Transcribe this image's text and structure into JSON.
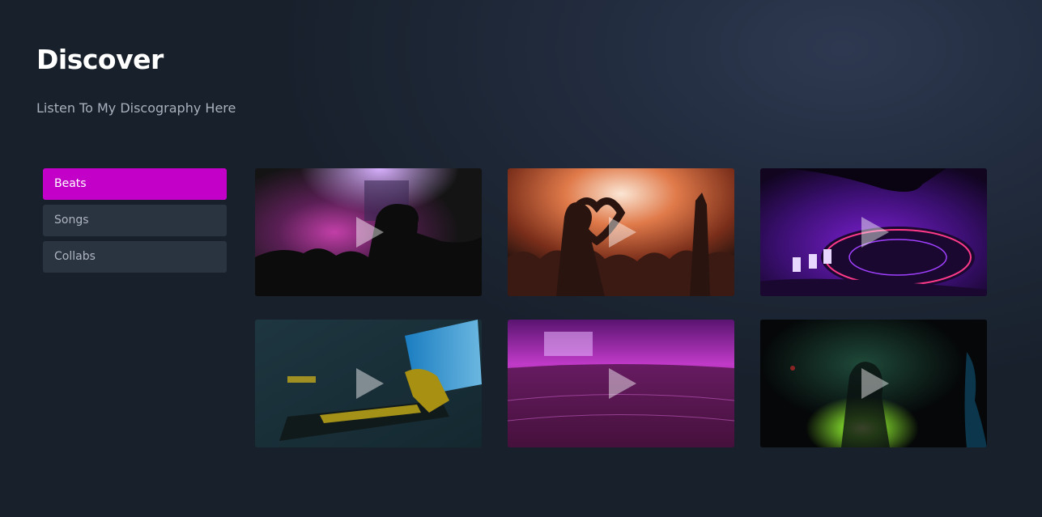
{
  "header": {
    "title": "Discover",
    "subtitle": "Listen To My Discography Here"
  },
  "sidebar": {
    "items": [
      {
        "label": "Beats",
        "active": true
      },
      {
        "label": "Songs",
        "active": false
      },
      {
        "label": "Collabs",
        "active": false
      }
    ]
  },
  "colors": {
    "accent": "#c200c8",
    "sidebar_item_bg": "#2a3440",
    "background": "#1e2736"
  },
  "cards": [
    {
      "scene": "concert-silhouette-pink-lights",
      "icon": "play-icon"
    },
    {
      "scene": "crowd-heart-hands-orange",
      "icon": "play-icon"
    },
    {
      "scene": "dj-turntable-purple",
      "icon": "play-icon"
    },
    {
      "scene": "dj-booth-teal-yellow",
      "icon": "play-icon"
    },
    {
      "scene": "stadium-crowd-magenta",
      "icon": "play-icon"
    },
    {
      "scene": "dark-club-green-light",
      "icon": "play-icon"
    }
  ]
}
